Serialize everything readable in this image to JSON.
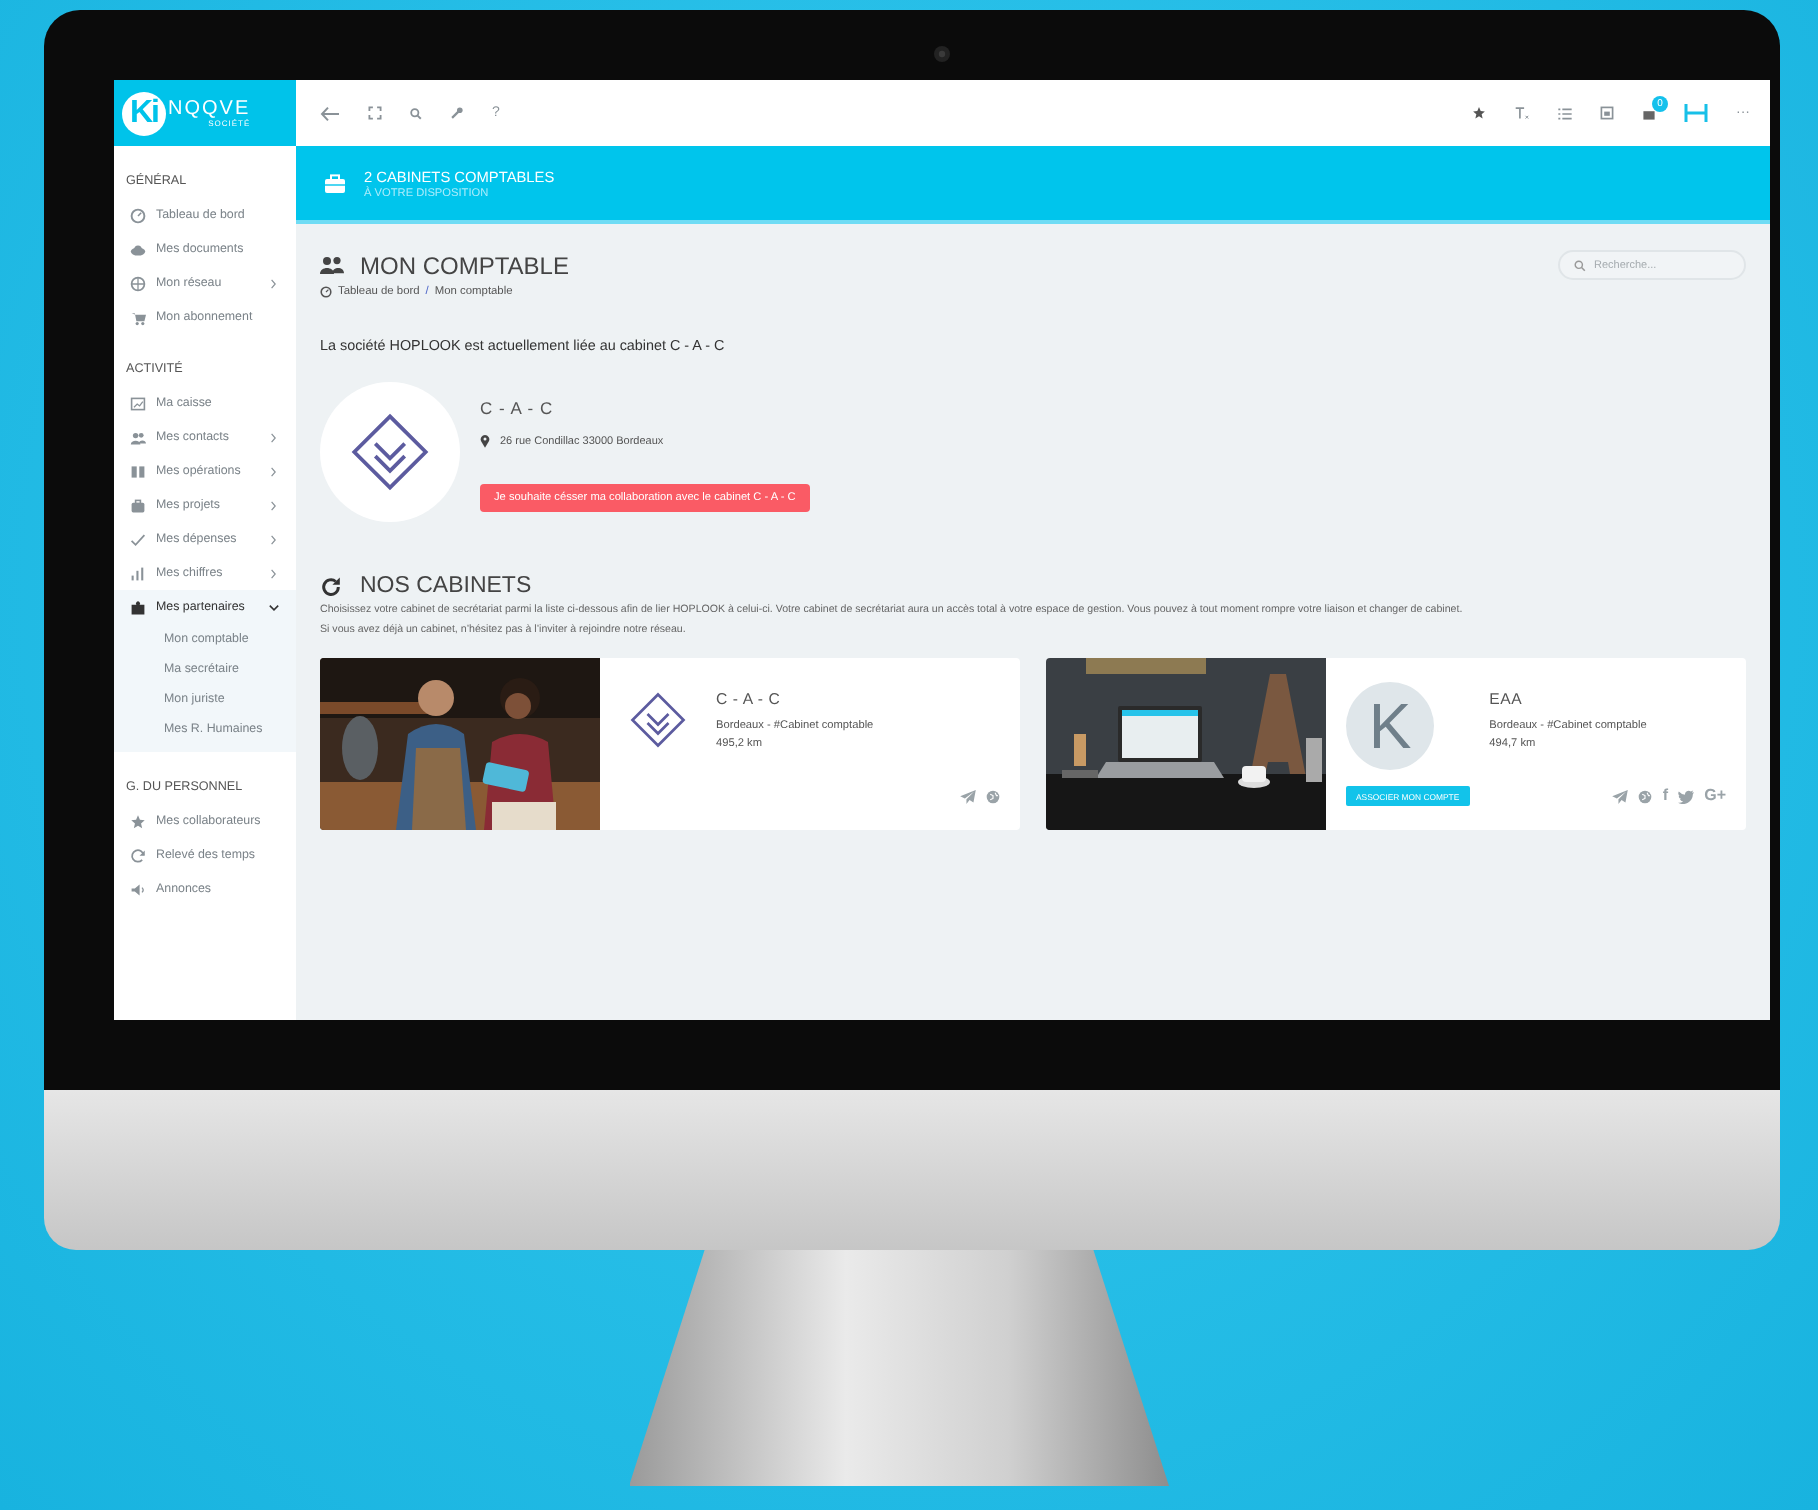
{
  "logo": {
    "mark": "Ki",
    "name": "NQQVE",
    "subtitle": "SOCIÉTÉ"
  },
  "sidebar": {
    "sections": [
      {
        "title": "GÉNÉRAL",
        "items": [
          {
            "label": "Tableau de bord",
            "kind": "link"
          },
          {
            "label": "Mes documents",
            "kind": "link"
          },
          {
            "label": "Mon réseau",
            "kind": "submenu",
            "expanded": false
          },
          {
            "label": "Mon abonnement",
            "kind": "link"
          }
        ]
      },
      {
        "title": "ACTIVITÉ",
        "items": [
          {
            "label": "Ma caisse",
            "kind": "link"
          },
          {
            "label": "Mes contacts",
            "kind": "submenu",
            "expanded": false
          },
          {
            "label": "Mes opérations",
            "kind": "submenu",
            "expanded": false
          },
          {
            "label": "Mes projets",
            "kind": "submenu",
            "expanded": false
          },
          {
            "label": "Mes dépenses",
            "kind": "submenu",
            "expanded": false
          },
          {
            "label": "Mes chiffres",
            "kind": "submenu",
            "expanded": false
          },
          {
            "label": "Mes partenaires",
            "kind": "submenu",
            "expanded": true,
            "children": [
              {
                "label": "Mon comptable"
              },
              {
                "label": "Ma secrétaire"
              },
              {
                "label": "Mon juriste"
              },
              {
                "label": "Mes R. Humaines"
              }
            ]
          }
        ]
      },
      {
        "title": "G. DU PERSONNEL",
        "items": [
          {
            "label": "Mes collaborateurs",
            "kind": "link"
          },
          {
            "label": "Relevé des temps",
            "kind": "link"
          },
          {
            "label": "Annonces",
            "kind": "link"
          }
        ]
      }
    ]
  },
  "toolbar": {
    "help": "?",
    "notification_count": "0",
    "more": "···"
  },
  "banner": {
    "title": "2 CABINETS COMPTABLES",
    "subtitle": "À VOTRE DISPOSITION"
  },
  "page": {
    "title": "MON COMPTABLE",
    "breadcrumb": [
      "Tableau de bord",
      "Mon comptable"
    ],
    "breadcrumb_separator": "/",
    "search": {
      "placeholder": "Recherche..."
    }
  },
  "statement": "La société HOPLOOK est actuellement liée au cabinet C - A - C",
  "current_cabinet": {
    "name": "C - A - C",
    "address": "26 rue Condillac 33000 Bordeaux",
    "button": "Je souhaite césser ma collaboration avec le cabinet C - A - C"
  },
  "cabinets_section": {
    "title": "NOS CABINETS",
    "description": [
      "Choisissez votre cabinet de secrétariat parmi la liste ci-dessous afin de lier HOPLOOK à celui-ci. Votre cabinet de secrétariat aura un accès total à votre espace de gestion. Vous pouvez à tout moment rompre votre liaison et changer de cabinet.",
      "Si vous avez déjà un cabinet, n’hésitez pas à l’inviter à rejoindre notre réseau."
    ]
  },
  "cabinets": [
    {
      "name": "C - A - C",
      "logo": {
        "kind": "diamond"
      },
      "category": "Bordeaux - #Cabinet comptable",
      "distance": "495,2 km",
      "socials": [
        {
          "kind": "send"
        },
        {
          "kind": "web"
        }
      ]
    },
    {
      "name": "EAA",
      "logo": {
        "kind": "letter",
        "letter": "K"
      },
      "category": "Bordeaux - #Cabinet comptable",
      "distance": "494,7 km",
      "button": "ASSOCIER MON COMPTE",
      "socials": [
        {
          "kind": "send"
        },
        {
          "kind": "web"
        },
        {
          "kind": "glyph",
          "text": "f"
        },
        {
          "kind": "twitter"
        },
        {
          "kind": "glyph",
          "text": "G+"
        }
      ]
    }
  ]
}
